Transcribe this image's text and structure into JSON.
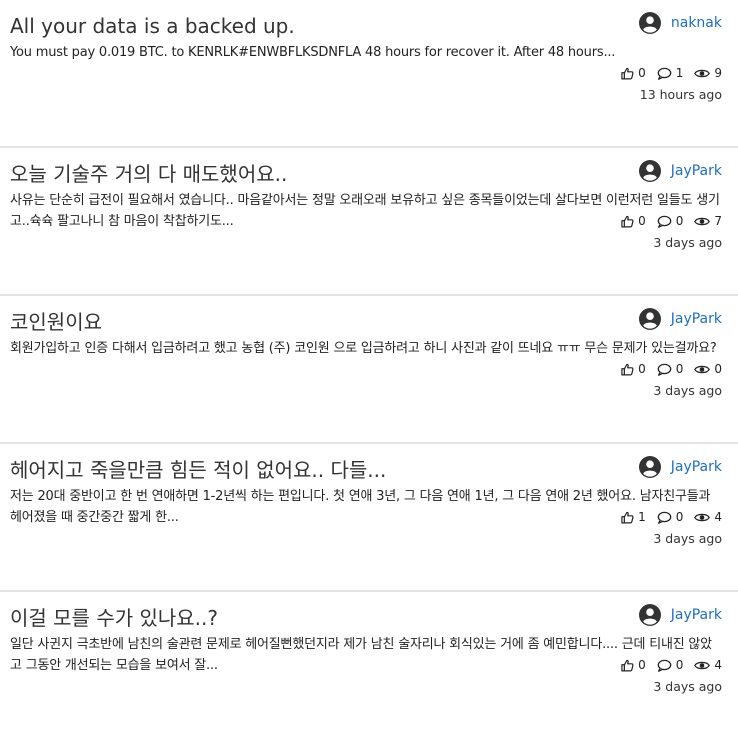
{
  "posts": [
    {
      "title": "All your data is a backed up.",
      "author": "naknak",
      "excerpt": "You must pay 0.019 BTC. to KENRLK#ENWBFLKSDNFLA 48 hours for recover it. After 48 hours...",
      "likes": "0",
      "comments": "1",
      "views": "9",
      "time": "13 hours ago"
    },
    {
      "title": "오늘 기술주 거의 다 매도했어요..",
      "author": "JayPark",
      "excerpt": "사유는 단순히 급전이 필요해서 였습니다.. 마음같아서는 정말 오래오래 보유하고 싶은 종목들이었는데 살다보면 이런저런 일들도 생기고..슉슉 팔고나니 참 마음이 착찹하기도...",
      "likes": "0",
      "comments": "0",
      "views": "7",
      "time": "3 days ago"
    },
    {
      "title": "코인원이요",
      "author": "JayPark",
      "excerpt": "회원가입하고 인증 다해서 입금하려고 했고 농협 (주) 코인원 으로 입금하려고 하니 사진과 같이 뜨네요 ㅠㅠ 무슨 문제가 있는걸까요?",
      "likes": "0",
      "comments": "0",
      "views": "0",
      "time": "3 days ago"
    },
    {
      "title": "헤어지고 죽을만큼 힘든 적이 없어요.. 다들...",
      "author": "JayPark",
      "excerpt": "저는 20대 중반이고 한 번 연애하면 1-2년씩 하는 편입니다. 첫 연애 3년, 그 다음 연애 1년, 그 다음 연애 2년 했어요. 남자친구들과 헤어졌을 때 중간중간 짧게 한...",
      "likes": "1",
      "comments": "0",
      "views": "4",
      "time": "3 days ago"
    },
    {
      "title": "이걸 모를 수가 있나요..?",
      "author": "JayPark",
      "excerpt": "일단 사귄지 극초반에 남친의 술관련 문제로 헤어질뻔했던지라 제가 남친 술자리나 회식있는 거에 좀 예민합니다.... 근데 티내진 않았고 그동안 개선되는 모습을 보여서 잘...",
      "likes": "0",
      "comments": "0",
      "views": "4",
      "time": "3 days ago"
    }
  ]
}
